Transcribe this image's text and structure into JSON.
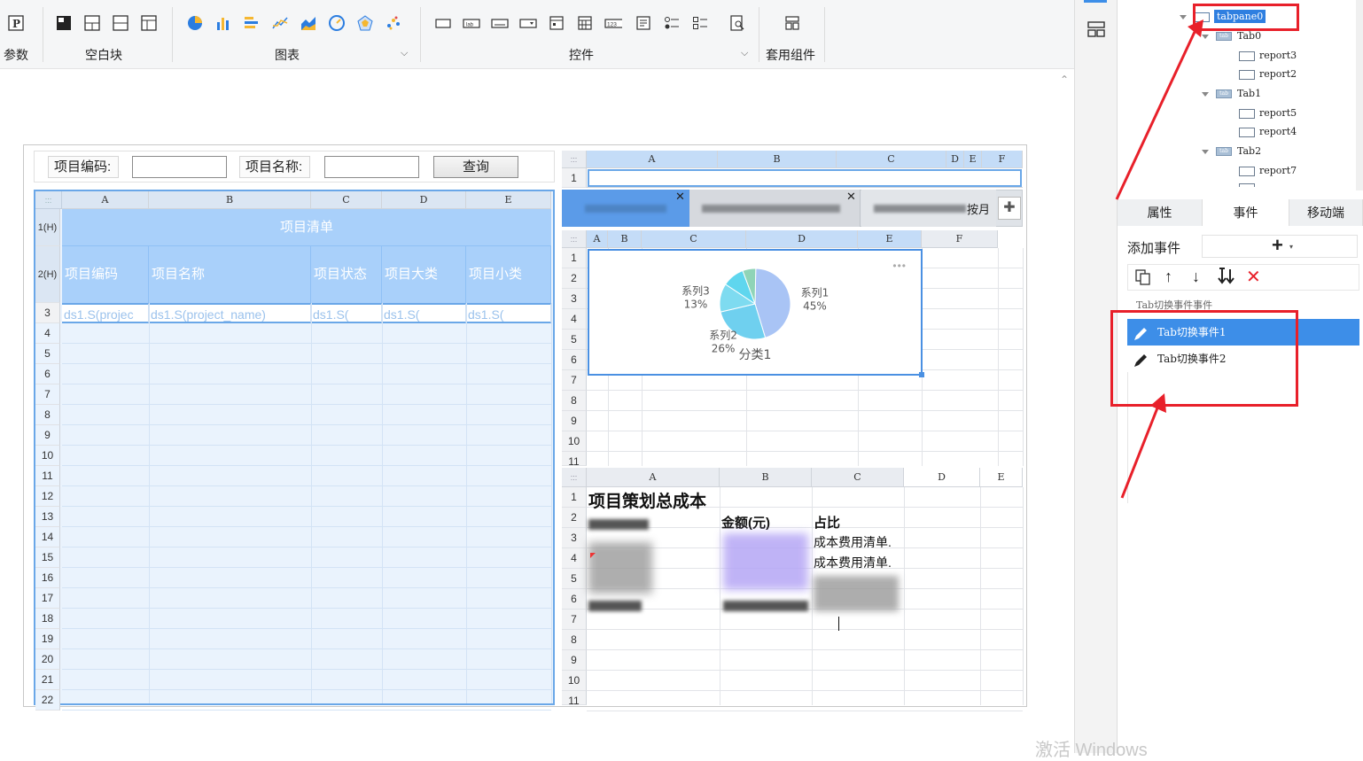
{
  "toolbar": {
    "param_label": "参数",
    "blank_label": "空白块",
    "chart_label": "图表",
    "controls_label": "控件",
    "template_label": "套用组件"
  },
  "form": {
    "code_label": "项目编码:",
    "name_label": "项目名称:",
    "query_button": "查询"
  },
  "left_sheet": {
    "columns": [
      "A",
      "B",
      "C",
      "D",
      "E"
    ],
    "row_header_1": "1(H)",
    "row_header_2": "2(H)",
    "title": "项目清单",
    "headers": [
      "项目编码",
      "项目名称",
      "项目状态",
      "项目大类",
      "项目小类"
    ],
    "data_row": [
      "ds1.S(projec",
      "ds1.S(project_name)",
      "ds1.S(",
      "ds1.S(",
      "ds1.S("
    ],
    "rows": [
      "3",
      "4",
      "5",
      "6",
      "7",
      "8",
      "9",
      "10",
      "11",
      "12",
      "13",
      "14",
      "15",
      "16",
      "17",
      "18",
      "19",
      "20",
      "21",
      "22"
    ]
  },
  "top_sheet": {
    "columns": [
      "A",
      "B",
      "C",
      "D",
      "E",
      "F"
    ],
    "row": "1"
  },
  "tabpane": {
    "tab3_suffix": "按月"
  },
  "chart_sheet": {
    "columns": [
      "A",
      "B",
      "C",
      "D",
      "E",
      "F"
    ],
    "rows": [
      "1",
      "2",
      "3",
      "4",
      "5",
      "6",
      "7",
      "8",
      "9",
      "10",
      "11"
    ]
  },
  "chart_data": {
    "type": "pie",
    "slices": [
      {
        "name": "系列1",
        "value": 45,
        "label": "45%",
        "color": "#a9c4f5"
      },
      {
        "name": "系列2",
        "value": 26,
        "label": "26%",
        "color": "#6fd0ef"
      },
      {
        "name": "系列3",
        "value": 13,
        "label": "13%",
        "color": "#7edbf0"
      },
      {
        "name": "",
        "value": 10,
        "label": "",
        "color": "#5fd6ee"
      },
      {
        "name": "",
        "value": 6,
        "label": "",
        "color": "#8fd4b7"
      }
    ],
    "category": "分类1",
    "more": "•••"
  },
  "cost_sheet": {
    "columns": [
      "A",
      "B",
      "C",
      "D",
      "E"
    ],
    "title": "项目策划总成本",
    "header_b": "金额(元)",
    "header_c": "占比",
    "cell_c3": "成本费用清单.",
    "cell_c4": "成本费用清单.",
    "rows": [
      "1",
      "2",
      "3",
      "4",
      "5",
      "6",
      "7",
      "8",
      "9",
      "10",
      "11"
    ]
  },
  "tree": {
    "tabpane": "tabpane0",
    "tab0": "Tab0",
    "report3": "report3",
    "report2": "report2",
    "tab1": "Tab1",
    "report5": "report5",
    "report4": "report4",
    "tab2": "Tab2",
    "report7": "report7"
  },
  "panel": {
    "tab_props": "属性",
    "tab_events": "事件",
    "tab_mobile": "移动端",
    "add_event": "添加事件",
    "plus": "+",
    "section": "Tab切换事件事件",
    "event1": "Tab切换事件1",
    "event2": "Tab切换事件2"
  },
  "watermark": "激活 Windows",
  "colors": {
    "accent": "#3d8ee8",
    "highlight": "#4a90e2",
    "red": "#e8202a"
  }
}
